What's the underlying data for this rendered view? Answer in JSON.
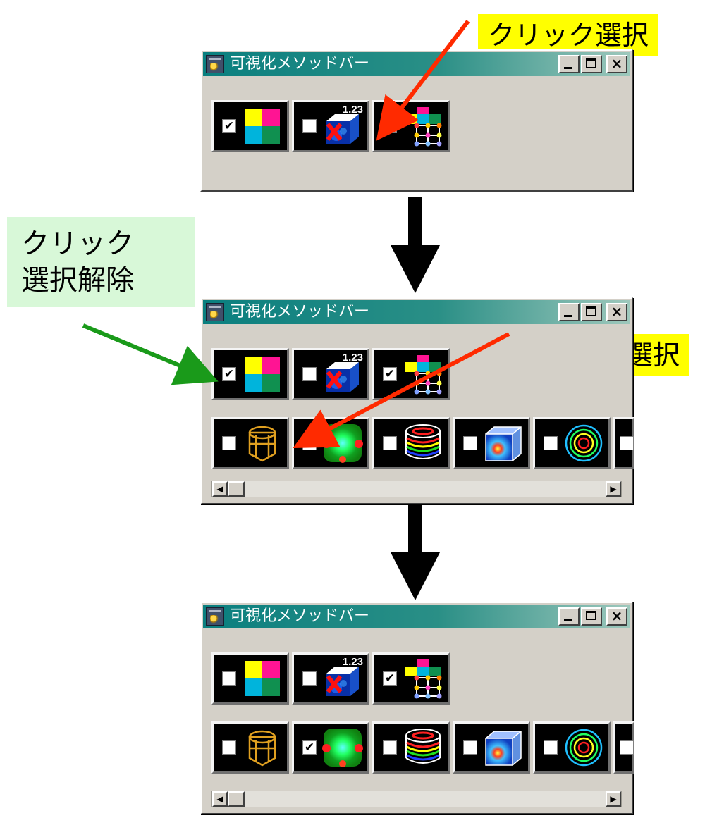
{
  "window_title": "可視化メソッドバー",
  "title_buttons": {
    "close": "×"
  },
  "scroll_arrows": {
    "left": "◀",
    "right": "▶"
  },
  "callouts": {
    "click_select_1": "クリック選択",
    "click_select_2": "クリック選択",
    "deselect_line1": "クリック",
    "deselect_line2": "選択解除"
  },
  "methods_row1": [
    {
      "icon": "color-quadrant-icon"
    },
    {
      "icon": "numeric-value-cube-icon",
      "badge": "1.23"
    },
    {
      "icon": "grid-nodes-icon"
    }
  ],
  "methods_row2": [
    {
      "icon": "wireframe-box-icon"
    },
    {
      "icon": "surface-contour-icon"
    },
    {
      "icon": "stacked-slices-icon"
    },
    {
      "icon": "volume-render-icon"
    },
    {
      "icon": "contour-rings-icon"
    }
  ],
  "windows": [
    {
      "state": "before",
      "row1_checked": [
        true,
        false,
        false
      ],
      "row2_checked": []
    },
    {
      "state": "after-first-click",
      "row1_checked": [
        true,
        false,
        true
      ],
      "row2_checked": [
        false,
        false,
        false,
        false,
        false,
        false
      ]
    },
    {
      "state": "final",
      "row1_checked": [
        false,
        false,
        true
      ],
      "row2_checked": [
        false,
        true,
        false,
        false,
        false,
        false
      ]
    }
  ],
  "colors": {
    "title_start": "#0a7f7f",
    "window_bg": "#d4d0c8",
    "red_arrow": "#ff2a00",
    "green_arrow": "#1a9a1a",
    "yellow_callout": "#ffff00",
    "green_callout": "#d8f8d8"
  }
}
